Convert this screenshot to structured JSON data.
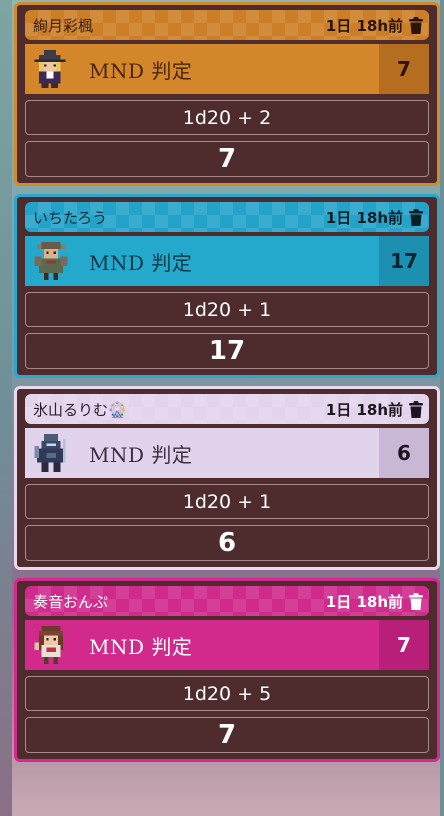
{
  "feed": [
    {
      "user": "絢月彩楓",
      "timestamp": "1日 18h前",
      "check": "MND 判定",
      "value": "7",
      "formula": "1d20 + 2",
      "result": "7",
      "colors": {
        "accent": "#d28a2a",
        "header": "#cc7f26",
        "row": "#d4862b",
        "value_bg": "#b56d1f",
        "name": "#3a2010",
        "timestamp": "#2a1508",
        "label": "#4a2608",
        "value": "#2a1508"
      },
      "avatar_icon": "witch-sprite-icon"
    },
    {
      "user": "いちたろう",
      "timestamp": "1日 18h前",
      "check": "MND 判定",
      "value": "17",
      "formula": "1d20 + 1",
      "result": "17",
      "colors": {
        "accent": "#2aa7cc",
        "header": "#23a3c9",
        "row": "#24a8cc",
        "value_bg": "#1d8fb1",
        "name": "#0f2e38",
        "timestamp": "#0a1e26",
        "label": "#0d3a48",
        "value": "#0a2530"
      },
      "avatar_icon": "warrior-sprite-icon"
    },
    {
      "user": "氷山るりむ🎡",
      "timestamp": "1日 18h前",
      "check": "MND 判定",
      "value": "6",
      "formula": "1d20 + 1",
      "result": "6",
      "colors": {
        "accent": "#e8d9ee",
        "header": "#e3d4ec",
        "row": "#e2d3ec",
        "value_bg": "#c9b7d6",
        "name": "#2a2030",
        "timestamp": "#1c1420",
        "label": "#3a3040",
        "value": "#1c1420"
      },
      "avatar_icon": "knight-sprite-icon"
    },
    {
      "user": "奏音おんぷ",
      "timestamp": "1日 18h前",
      "check": "MND 判定",
      "value": "7",
      "formula": "1d20 + 5",
      "result": "7",
      "colors": {
        "accent": "#d42a8f",
        "header": "#cf2a8c",
        "row": "#d12a8c",
        "value_bg": "#b81f78",
        "name": "#ffffff",
        "timestamp": "#ffffff",
        "label": "#ffffff",
        "value": "#ffffff"
      },
      "avatar_icon": "girl-sprite-icon"
    }
  ]
}
